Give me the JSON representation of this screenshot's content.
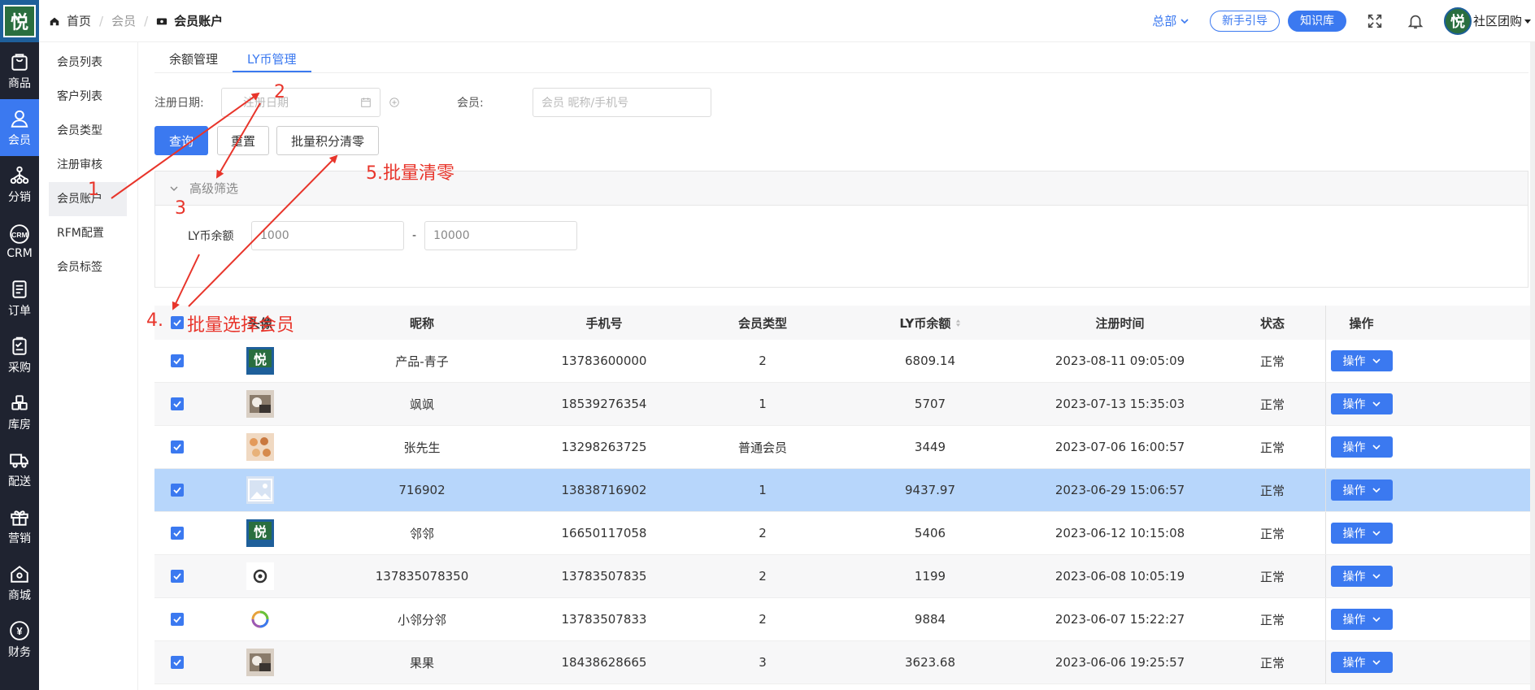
{
  "app_logo": "悦",
  "header": {
    "breadcrumb": [
      "首页",
      "会员",
      "会员账户"
    ],
    "branch": "总部",
    "guide_label": "新手引导",
    "kb_label": "知识库",
    "store_name": "社区团购"
  },
  "iconbar": [
    {
      "label": "商品",
      "icon": "bag-icon"
    },
    {
      "label": "会员",
      "icon": "user-icon"
    },
    {
      "label": "分销",
      "icon": "network-icon"
    },
    {
      "label": "CRM",
      "icon": "crm-icon"
    },
    {
      "label": "订单",
      "icon": "order-icon"
    },
    {
      "label": "采购",
      "icon": "clipboard-icon"
    },
    {
      "label": "库房",
      "icon": "warehouse-icon"
    },
    {
      "label": "配送",
      "icon": "truck-icon"
    },
    {
      "label": "营销",
      "icon": "gift-icon"
    },
    {
      "label": "商城",
      "icon": "home-icon"
    },
    {
      "label": "财务",
      "icon": "yen-icon"
    }
  ],
  "subnav": [
    "会员列表",
    "客户列表",
    "会员类型",
    "注册审核",
    "会员账户",
    "RFM配置",
    "会员标签"
  ],
  "tabs": [
    "余额管理",
    "LY币管理"
  ],
  "filters": {
    "reg_date_label": "注册日期:",
    "reg_date_placeholder": "注册日期",
    "member_label": "会员:",
    "member_placeholder": "会员 昵称/手机号",
    "query": "查询",
    "reset": "重置",
    "batch_clear": "批量积分清零",
    "advanced": "高级筛选",
    "ly_balance_label": "LY币余额",
    "ly_min": "1000",
    "ly_sep": "-",
    "ly_max": "10000"
  },
  "table": {
    "headers": [
      "头像",
      "昵称",
      "手机号",
      "会员类型",
      "LY币余额",
      "注册时间",
      "状态",
      "操作"
    ],
    "op_label": "操作",
    "rows": [
      {
        "avatar": "logo",
        "nickname": "产品-青子",
        "phone": "13783600000",
        "type": "2",
        "balance": "6809.14",
        "time": "2023-08-11 09:05:09",
        "status": "正常"
      },
      {
        "avatar": "photo-cat",
        "nickname": "飒飒",
        "phone": "18539276354",
        "type": "1",
        "balance": "5707",
        "time": "2023-07-13 15:35:03",
        "status": "正常"
      },
      {
        "avatar": "photo-food",
        "nickname": "张先生",
        "phone": "13298263725",
        "type": "普通会员",
        "balance": "3449",
        "time": "2023-07-06 16:00:57",
        "status": "正常"
      },
      {
        "avatar": "placeholder",
        "nickname": "716902",
        "phone": "13838716902",
        "type": "1",
        "balance": "9437.97",
        "time": "2023-06-29 15:06:57",
        "status": "正常"
      },
      {
        "avatar": "logo",
        "nickname": "邻邻",
        "phone": "16650117058",
        "type": "2",
        "balance": "5406",
        "time": "2023-06-12 10:15:08",
        "status": "正常"
      },
      {
        "avatar": "swirl",
        "nickname": "137835078350",
        "phone": "13783507835",
        "type": "2",
        "balance": "1199",
        "time": "2023-06-08 10:05:19",
        "status": "正常"
      },
      {
        "avatar": "ring",
        "nickname": "小邻分邻",
        "phone": "13783507833",
        "type": "2",
        "balance": "9884",
        "time": "2023-06-07 15:22:27",
        "status": "正常"
      },
      {
        "avatar": "photo-cat",
        "nickname": "果果",
        "phone": "18438628665",
        "type": "3",
        "balance": "3623.68",
        "time": "2023-06-06 19:25:57",
        "status": "正常"
      }
    ]
  },
  "annotations": {
    "a1": "1",
    "a2": "2",
    "a3": "3",
    "a4_num": "4.",
    "a4": "批量选择会员",
    "a5": "5.批量清零"
  }
}
